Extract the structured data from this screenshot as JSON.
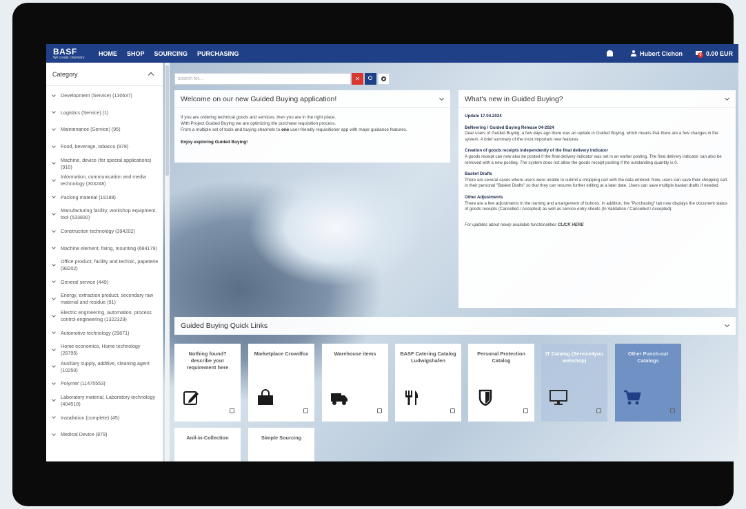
{
  "nav": {
    "brand": "BASF",
    "tagline": "We create chemistry",
    "links": [
      "HOME",
      "SHOP",
      "SOURCING",
      "PURCHASING"
    ],
    "user": "Hubert Cichon",
    "cart_total": "0.00 EUR",
    "cart_count": "0"
  },
  "sidebar": {
    "title": "Category",
    "items": [
      "Development (Service) (130637)",
      "Logistics (Service) (1)",
      "Maintenance (Service) (95)",
      "Food, beverage, tobacco (978)",
      "Machine, device (for special applications) (910)",
      "Information, communication and media technology (303248)",
      "Packing material (19188)",
      "Manufacturing facility, workshop equipment, tool (533830)",
      "Construction technology (394202)",
      "Machine element, fixing, mounting (684179)",
      "Office product, facility and technic, papeterie (98202)",
      "General service (449)",
      "Energy, extraction product, secondary raw material and residue (91)",
      "Electric engineering, automation, process control engineering (1322329)",
      "Automotive technology (29871)",
      "Home economics, Home technology (28795)",
      "Auxiliary supply, additive, cleaning agent (10250)",
      "Polymer (11475553)",
      "Laboratory material, Laboratory technology (404518)",
      "Installation (complete) (45)",
      "Medical Device (879)"
    ]
  },
  "search": {
    "placeholder": "search for..."
  },
  "welcome": {
    "title": "Welcome on our new Guided Buying application!",
    "line1": "If you are ordering technical goods and services, then you are in the right place.",
    "line2": "With Project Guided Buying we are optimizing the purchase requisition process.",
    "line3_pre": "From a multiple set of tools and buying channels to ",
    "line3_bold": "one",
    "line3_post": " user-friendly requisitioner app with major guidance features.",
    "closing": "Enjoy exploring Guided Buying!"
  },
  "whatsnew": {
    "title": "What's new in Guided Buying?",
    "update": "Update 17.04.2024",
    "sections": [
      {
        "heading": "BeNeering / Guided Buying Release 04-2024",
        "text": "Dear users of Guided Buying, a few days ago there was an update in Guided Buying, which means that there are a few changes in the system. A brief summary of the most important new features:"
      },
      {
        "heading": "Creation of goods receipts independently of the final delivery indicator",
        "text": "A goods receipt can now also be posted if the final delivery indicator was set in an earlier posting. The final delivery indicator can also be removed with a new posting. The system does not allow the goods receipt posting if the outstanding quantity is 0."
      },
      {
        "heading": "Basket Drafts",
        "text": "There are several cases where users were unable to submit a shopping cart with the data entered. Now, users can save their shopping cart in their personal \"Basket Drafts\" so that they can resume further editing at a later date. Users can save multiple basket drafts if needed."
      },
      {
        "heading": "Other Adjustments",
        "text": "There are a few adjustments in the naming and arrangement of buttons. In addition, the \"Purchasing\" tab now displays the document status of goods receipts (Cancelled / Accepted) as well as service entry sheets (In Validation / Cancelled / Accepted)."
      }
    ],
    "footer_pre": "For updates about newly available functionalities ",
    "footer_link": "CLICK HERE"
  },
  "quick": {
    "title": "Guided Buying Quick Links",
    "tiles": [
      {
        "label": "Nothing found? describe your requirement here",
        "icon": "edit-icon"
      },
      {
        "label": "Marketplace Crowdfox",
        "icon": "shopping-bag-icon"
      },
      {
        "label": "Warehouse items",
        "icon": "truck-icon"
      },
      {
        "label": "BASF Catering Catalog Ludwigshafen",
        "icon": "cutlery-icon"
      },
      {
        "label": "Personal Protection Catalog",
        "icon": "shield-icon"
      },
      {
        "label": "IT Catalog (Service4you webshop)",
        "icon": "monitor-icon"
      },
      {
        "label": "Other Punch-out Catalogs",
        "icon": "cart-icon"
      },
      {
        "label": "Anil-in-Collection",
        "icon": ""
      },
      {
        "label": "Simple Sourcing",
        "icon": ""
      }
    ]
  },
  "colors": {
    "nav": "#1f3f86",
    "accent_red": "#d9362f",
    "tile_blue": "#6f91c4"
  }
}
